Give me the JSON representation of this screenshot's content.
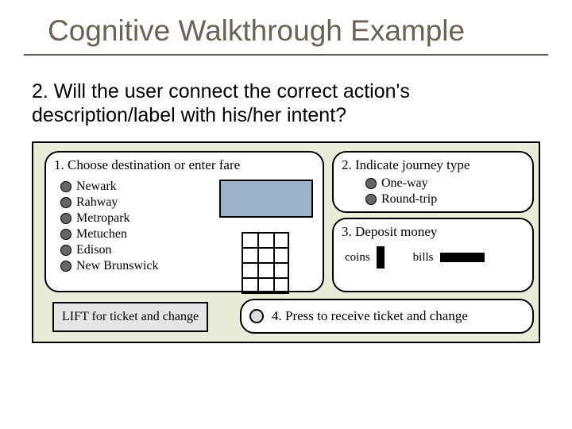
{
  "title": "Cognitive Walkthrough Example",
  "question": "2. Will the user connect the correct action's description/label with his/her intent?",
  "panel1": {
    "title": "1. Choose destination or enter fare",
    "destinations": [
      "Newark",
      "Rahway",
      "Metropark",
      "Metuchen",
      "Edison",
      "New Brunswick"
    ]
  },
  "panel2": {
    "title": "2. Indicate journey type",
    "options": [
      "One-way",
      "Round-trip"
    ]
  },
  "panel3": {
    "title": "3. Deposit money",
    "coins_label": "coins",
    "bills_label": "bills"
  },
  "lift_label": "LIFT for ticket and change",
  "panel4": {
    "label": "4. Press to receive ticket and change"
  }
}
